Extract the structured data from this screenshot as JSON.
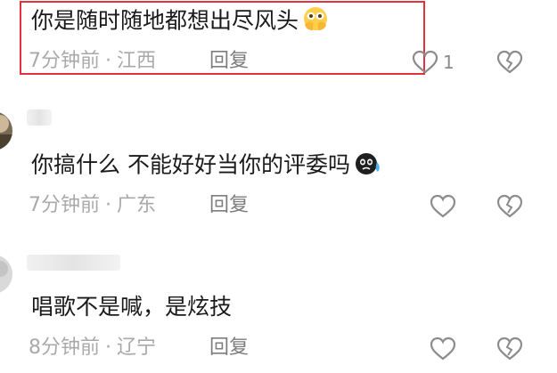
{
  "comments": [
    {
      "text": "你是随时随地都想出尽风头",
      "emoji": "hands-over-face-emoji",
      "time": "7分钟前",
      "location": "江西",
      "reply_label": "回复",
      "like_count": "1",
      "highlighted": true
    },
    {
      "text": "你搞什么 不能好好当你的评委吗",
      "emoji": "cold-sweat-emoji",
      "time": "7分钟前",
      "location": "广东",
      "reply_label": "回复"
    },
    {
      "text": "唱歌不是喊，是炫技",
      "time": "8分钟前",
      "location": "辽宁",
      "reply_label": "回复"
    }
  ],
  "meta_separator": "·",
  "colors": {
    "highlight": "#e2323a",
    "meta_text": "#a9a9a9",
    "icon_stroke": "#8c8c8c"
  }
}
